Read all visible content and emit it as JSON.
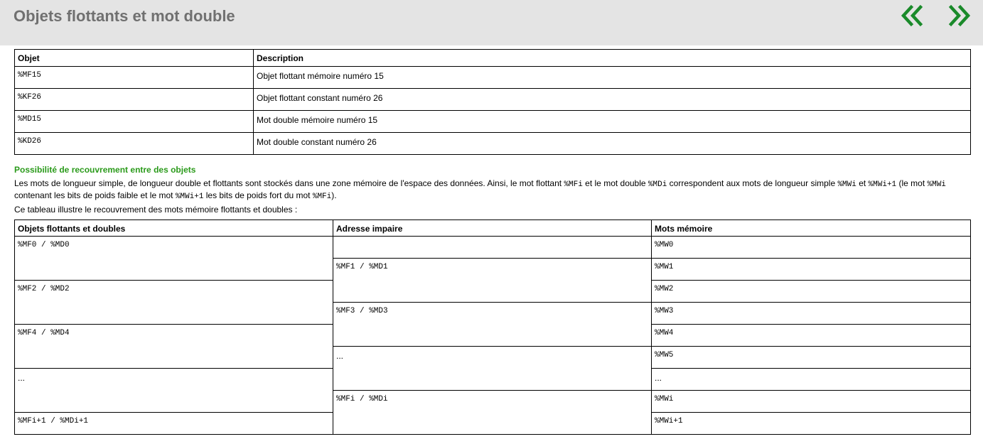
{
  "header": {
    "title": "Objets flottants et mot double",
    "prev_icon": "double-chevron-left-icon",
    "next_icon": "double-chevron-right-icon",
    "accent_color": "#1a8a2a"
  },
  "table1": {
    "headers": [
      "Objet",
      "Description"
    ],
    "rows": [
      {
        "obj": "%MF15",
        "desc": "Objet flottant mémoire numéro 15"
      },
      {
        "obj": "%KF26",
        "desc": "Objet flottant constant numéro 26"
      },
      {
        "obj": "%MD15",
        "desc": "Mot double mémoire numéro 15"
      },
      {
        "obj": "%KD26",
        "desc": "Mot double constant numéro 26"
      }
    ]
  },
  "section": {
    "title": "Possibilité de recouvrement entre des objets",
    "para": {
      "t1": "Les mots de longueur simple, de longueur double et flottants sont stockés dans une zone mémoire de l'espace des données. Ainsi, le mot flottant ",
      "c1": "%MFi",
      "t2": " et le mot double ",
      "c2": "%MDi",
      "t3": " correspondent aux mots de longueur simple ",
      "c3": "%MWi",
      "t4": " et ",
      "c4": "%MWi+1",
      "t5": " (le mot ",
      "c5": "%MWi",
      "t6": " contenant les bits de poids faible et le mot ",
      "c6": "%MWi+1",
      "t7": " les bits de poids fort du mot ",
      "c7": "%MFi",
      "t8": ")."
    },
    "para2": "Ce tableau illustre le recouvrement des mots mémoire flottants et doubles :"
  },
  "table2": {
    "headers": [
      "Objets flottants et doubles",
      "Adresse impaire",
      "Mots mémoire"
    ],
    "col1": [
      "%MF0 / %MD0",
      "%MF2 / %MD2",
      "%MF4 / %MD4",
      "...",
      "%MFi+1 / %MDi+1"
    ],
    "col2": [
      "%MF1 / %MD1",
      "%MF3 / %MD3",
      "...",
      "%MFi / %MDi"
    ],
    "col3": [
      "%MW0",
      "%MW1",
      "%MW2",
      "%MW3",
      "%MW4",
      "%MW5",
      "...",
      "%MWi",
      "%MWi+1"
    ]
  }
}
